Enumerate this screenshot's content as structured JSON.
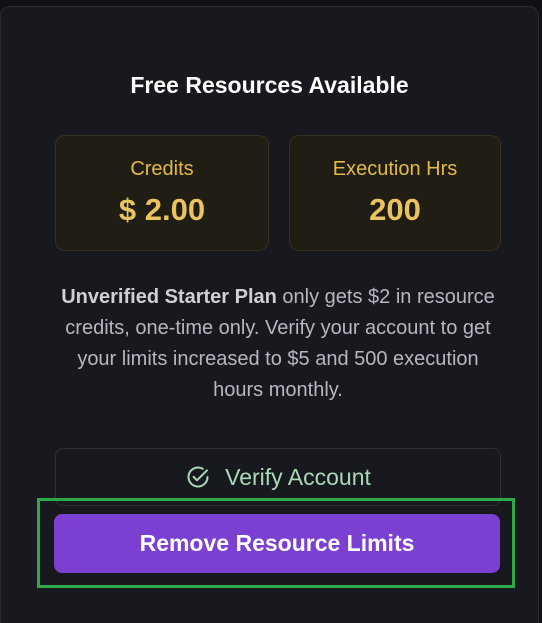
{
  "panel": {
    "title": "Free Resources Available",
    "cards": {
      "credits": {
        "label": "Credits",
        "value": "$ 2.00"
      },
      "execution": {
        "label": "Execution Hrs",
        "value": "200"
      }
    },
    "description": {
      "bold": "Unverified Starter Plan",
      "rest": " only gets $2 in resource credits, one-time only. Verify your account to get your limits increased to $5 and 500 execution hours monthly."
    },
    "verify_button": {
      "label": "Verify Account",
      "icon": "check-circle-icon"
    },
    "remove_button": {
      "label": "Remove Resource Limits"
    }
  },
  "colors": {
    "accent_purple": "#7b3fd1",
    "gold": "#e3b948",
    "verify_green": "#a9d9b6",
    "highlight_green": "#2fa84a"
  }
}
